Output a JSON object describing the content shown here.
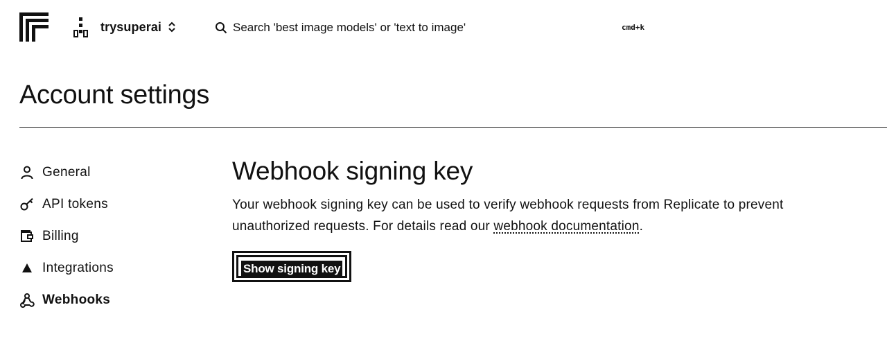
{
  "header": {
    "logo_icon": "replicate-logo-icon",
    "org": {
      "icon": "org-icon",
      "name": "trysuperai",
      "chevron_icon": "chevron-up-down-icon"
    },
    "search": {
      "icon": "search-icon",
      "placeholder": "Search 'best image models' or 'text to image'",
      "value": "",
      "shortcut": "cmd+k"
    }
  },
  "page": {
    "title": "Account settings"
  },
  "sidebar": {
    "items": [
      {
        "label": "General",
        "icon": "person-icon",
        "active": false
      },
      {
        "label": "API tokens",
        "icon": "key-icon",
        "active": false
      },
      {
        "label": "Billing",
        "icon": "wallet-icon",
        "active": false
      },
      {
        "label": "Integrations",
        "icon": "triangle-icon",
        "active": false
      },
      {
        "label": "Webhooks",
        "icon": "webhook-icon",
        "active": true
      }
    ]
  },
  "main": {
    "title": "Webhook signing key",
    "description_prefix": "Your webhook signing key can be used to verify webhook requests from Replicate to prevent unauthorized requests. For details read our ",
    "link_text": "webhook documentation",
    "description_suffix": ".",
    "button_label": "Show signing key"
  },
  "colors": {
    "text": "#111111",
    "background": "#ffffff"
  }
}
